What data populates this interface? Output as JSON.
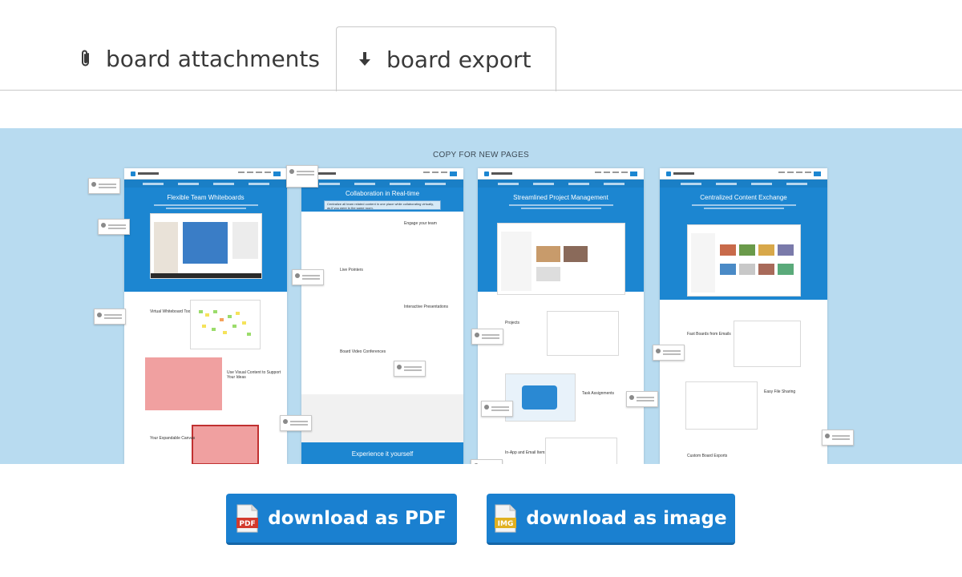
{
  "tabs": [
    {
      "label": "board attachments",
      "icon": "paperclip-icon",
      "active": false
    },
    {
      "label": "board export",
      "icon": "download-arrow-icon",
      "active": true
    }
  ],
  "preview": {
    "caption": "COPY FOR NEW PAGES",
    "pages": [
      {
        "title": "Flexible Team Whiteboards",
        "sections": [
          "Virtual Whiteboard Tools",
          "Use Visual Content to Support Your Ideas",
          "Your Expandable Canvas"
        ]
      },
      {
        "title": "Collaboration in Real-time",
        "tagline": "Centralize all team related content in one place while collaborating virtually, as if you were in the same room.",
        "sections": [
          "Engage your team",
          "Live Pointers",
          "Interactive Presentations",
          "Board Video Conferences"
        ],
        "cta": "Experience it yourself"
      },
      {
        "title": "Streamlined Project Management",
        "sections": [
          "Projects",
          "Task Assignments",
          "In-App and Email Items"
        ]
      },
      {
        "title": "Centralized Content Exchange",
        "sections": [
          "Fast Boards from Emails",
          "Easy File Sharing",
          "Custom Board Exports"
        ]
      }
    ]
  },
  "buttons": {
    "pdf_label": "download as PDF",
    "pdf_badge": "PDF",
    "image_label": "download as image",
    "image_badge": "IMG"
  },
  "colors": {
    "accent": "#1a80d0",
    "preview_bg": "#b8dbf0",
    "hero_blue": "#1c86d1",
    "pdf_red": "#d33a2c",
    "img_yellow": "#e0b020"
  }
}
